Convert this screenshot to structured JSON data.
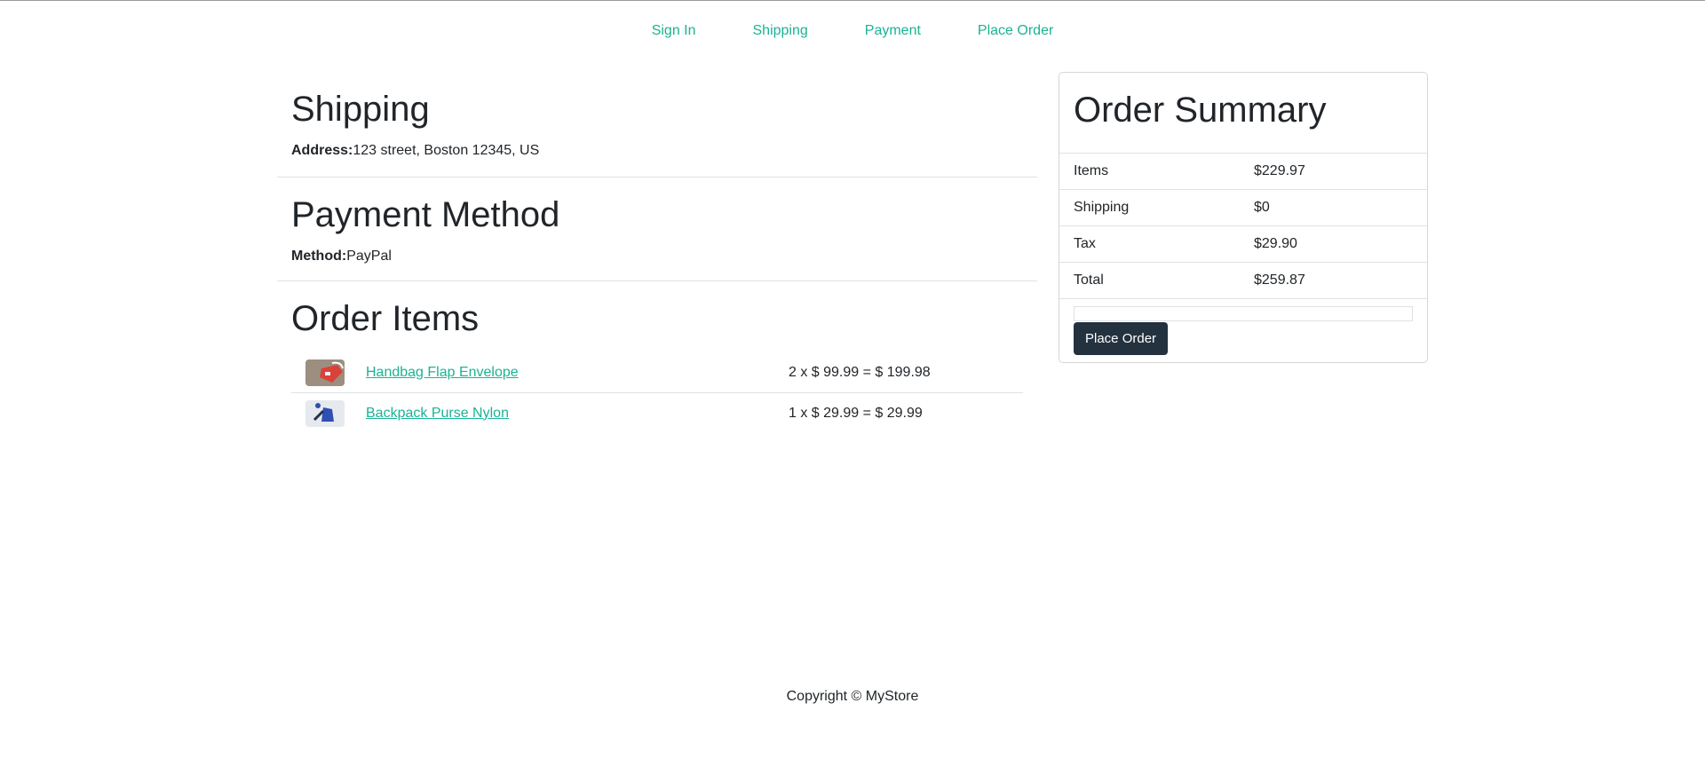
{
  "steps": [
    "Sign In",
    "Shipping",
    "Payment",
    "Place Order"
  ],
  "shipping": {
    "title": "Shipping",
    "address_label": "Address:",
    "address_value": "123 street, Boston 12345, US"
  },
  "payment": {
    "title": "Payment Method",
    "method_label": "Method:",
    "method_value": "PayPal"
  },
  "order_items": {
    "title": "Order Items",
    "items": [
      {
        "name": "Handbag Flap Envelope",
        "price_line": "2 x $ 99.99 = $ 199.98",
        "thumb_color": "#d9413a"
      },
      {
        "name": "Backpack Purse Nylon",
        "price_line": "1 x $ 29.99 = $ 29.99",
        "thumb_color": "#2f4fb5"
      }
    ]
  },
  "summary": {
    "title": "Order Summary",
    "rows": [
      {
        "label": "Items",
        "value": "$229.97"
      },
      {
        "label": "Shipping",
        "value": "$0"
      },
      {
        "label": "Tax",
        "value": "$29.90"
      },
      {
        "label": "Total",
        "value": "$259.87"
      }
    ],
    "button_label": "Place Order"
  },
  "footer": {
    "text": "Copyright © MyStore"
  },
  "colors": {
    "accent": "#1ab394",
    "button": "#24313f"
  }
}
